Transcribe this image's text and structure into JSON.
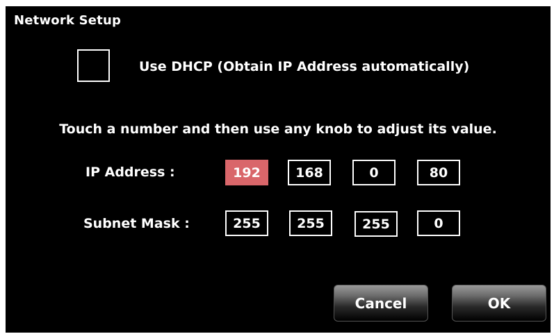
{
  "window": {
    "title": "Network Setup"
  },
  "dhcp": {
    "checked": false,
    "label": "Use DHCP (Obtain IP Address automatically)"
  },
  "instruction": "Touch a number and then use any knob to adjust its value.",
  "ip_address": {
    "label": "IP Address :",
    "octets": [
      "192",
      "168",
      "0",
      "80"
    ],
    "selected_octet": 0
  },
  "subnet_mask": {
    "label": "Subnet Mask :",
    "octets": [
      "255",
      "255",
      "255",
      "0"
    ]
  },
  "buttons": {
    "cancel_label": "Cancel",
    "ok_label": "OK"
  },
  "colors": {
    "background": "#000000",
    "text": "#ffffff",
    "selected_field": "#d9666a"
  }
}
